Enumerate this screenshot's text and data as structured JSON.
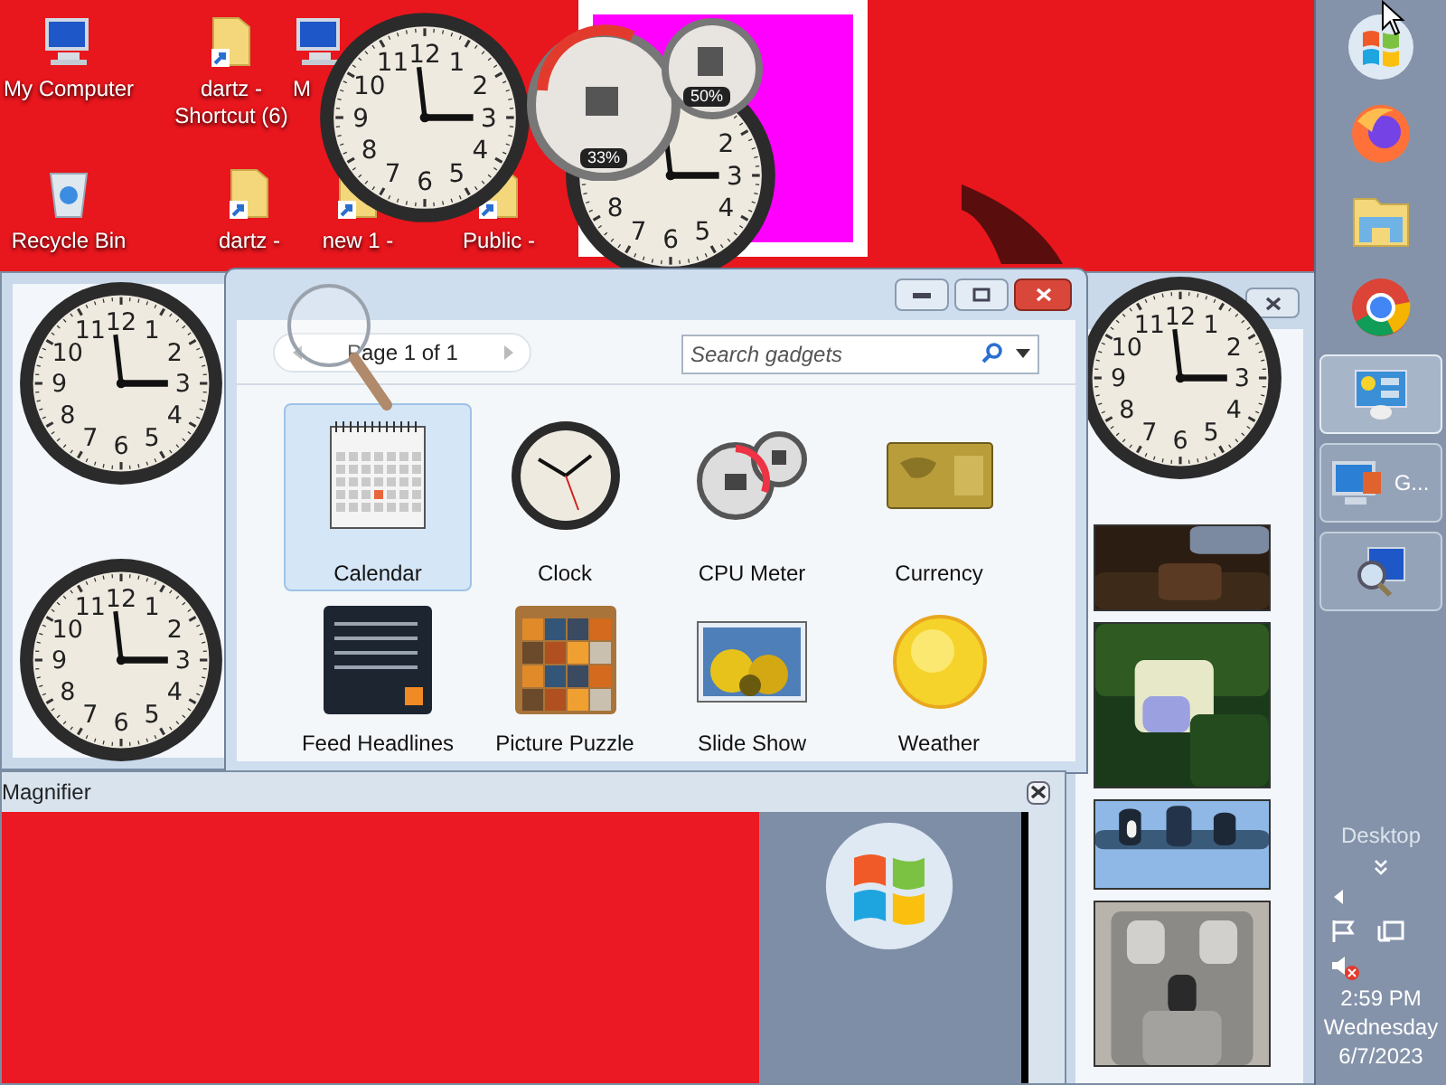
{
  "desktop_icons": [
    {
      "label": "My Computer",
      "kind": "computer"
    },
    {
      "label": "dartz - Shortcut (6)",
      "kind": "folder"
    },
    {
      "label": "M",
      "kind": "computer"
    },
    {
      "label": "Recycle Bin",
      "kind": "bin"
    },
    {
      "label": "dartz -",
      "kind": "folder"
    },
    {
      "label": "new 1 -",
      "kind": "folder"
    },
    {
      "label": "Public -",
      "kind": "folder"
    }
  ],
  "clocks": [
    {
      "kind": "full",
      "numerals": [
        "11",
        "12",
        "1",
        "10",
        "2",
        "9",
        "3",
        "8",
        "4",
        "7",
        "6",
        "5"
      ]
    },
    {
      "kind": "partial",
      "numerals": [
        "2",
        "3",
        "8",
        "4",
        "7",
        "6",
        "5"
      ]
    },
    {
      "kind": "full",
      "numerals": [
        "11",
        "12",
        "1",
        "10",
        "2",
        "9",
        "3",
        "8",
        "4",
        "7",
        "6",
        "5"
      ]
    },
    {
      "kind": "full",
      "numerals": [
        "11",
        "12",
        "1",
        "10",
        "2",
        "9",
        "3",
        "8",
        "4",
        "7",
        "6",
        "5"
      ]
    },
    {
      "kind": "full",
      "numerals": [
        "11",
        "12",
        "1",
        "10",
        "2",
        "9",
        "3",
        "8",
        "4",
        "7",
        "6",
        "5"
      ]
    }
  ],
  "cpu_meter": {
    "readings": [
      "33%",
      "50%"
    ]
  },
  "gallery": {
    "pager": {
      "label": "Page 1 of 1"
    },
    "search": {
      "placeholder": "Search gadgets"
    },
    "gadgets": [
      {
        "name": "Calendar",
        "kind": "calendar",
        "selected": true
      },
      {
        "name": "Clock",
        "kind": "clock",
        "selected": false
      },
      {
        "name": "CPU Meter",
        "kind": "cpu",
        "selected": false
      },
      {
        "name": "Currency",
        "kind": "currency",
        "selected": false
      },
      {
        "name": "Feed Headlines",
        "kind": "feed",
        "selected": false
      },
      {
        "name": "Picture Puzzle",
        "kind": "puzzle",
        "selected": false
      },
      {
        "name": "Slide Show",
        "kind": "slideshow",
        "selected": false
      },
      {
        "name": "Weather",
        "kind": "weather",
        "selected": false
      }
    ]
  },
  "magnifier": {
    "title": "Magnifier"
  },
  "taskbar": {
    "pinned": [
      {
        "kind": "start"
      },
      {
        "kind": "firefox"
      },
      {
        "kind": "explorer"
      },
      {
        "kind": "chrome"
      }
    ],
    "buttons": [
      {
        "kind": "gadgets",
        "active": true
      },
      {
        "kind": "computer",
        "label": "G...",
        "active": false
      },
      {
        "kind": "magnifier",
        "active": false
      }
    ],
    "desktop_label": "Desktop",
    "time": "2:59 PM",
    "day": "Wednesday",
    "date": "6/7/2023"
  }
}
